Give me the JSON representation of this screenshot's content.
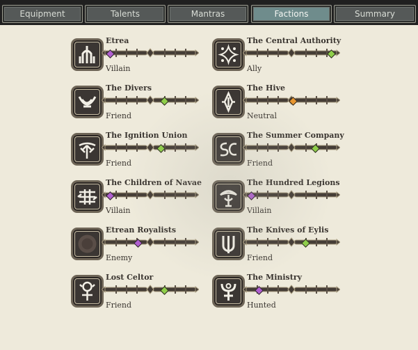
{
  "tabs": [
    {
      "label": "Equipment",
      "active": false
    },
    {
      "label": "Talents",
      "active": false
    },
    {
      "label": "Mantras",
      "active": false
    },
    {
      "label": "Factions",
      "active": true
    },
    {
      "label": "Summary",
      "active": false
    }
  ],
  "factions": [
    {
      "name": "Etrea",
      "status": "Villain",
      "standing": 0.03,
      "marker_color": "#b05fd0",
      "icon": "etrea-emblem-icon"
    },
    {
      "name": "The Central Authority",
      "status": "Ally",
      "standing": 0.93,
      "marker_color": "#8fcf49",
      "icon": "central-authority-emblem-icon"
    },
    {
      "name": "The Divers",
      "status": "Friend",
      "standing": 0.64,
      "marker_color": "#8fcf49",
      "icon": "divers-emblem-icon"
    },
    {
      "name": "The Hive",
      "status": "Neutral",
      "standing": 0.5,
      "marker_color": "#e8962f",
      "icon": "hive-emblem-icon"
    },
    {
      "name": "The Ignition Union",
      "status": "Friend",
      "standing": 0.6,
      "marker_color": "#8fcf49",
      "icon": "ignition-union-emblem-icon"
    },
    {
      "name": "The Summer Company",
      "status": "Friend",
      "standing": 0.75,
      "marker_color": "#8fcf49",
      "icon": "summer-company-emblem-icon"
    },
    {
      "name": "The Children of Navae",
      "status": "Villain",
      "standing": 0.03,
      "marker_color": "#b05fd0",
      "icon": "children-of-navae-emblem-icon"
    },
    {
      "name": "The Hundred Legions",
      "status": "Villain",
      "standing": 0.03,
      "marker_color": "#b05fd0",
      "icon": "hundred-legions-emblem-icon"
    },
    {
      "name": "Etrean Royalists",
      "status": "Enemy",
      "standing": 0.34,
      "marker_color": "#b05fd0",
      "icon": "etrean-royalists-emblem-icon"
    },
    {
      "name": "The Knives of Eylis",
      "status": "Friend",
      "standing": 0.64,
      "marker_color": "#8fcf49",
      "icon": "knives-of-eylis-emblem-icon"
    },
    {
      "name": "Lost Celtor",
      "status": "Friend",
      "standing": 0.64,
      "marker_color": "#8fcf49",
      "icon": "lost-celtor-emblem-icon"
    },
    {
      "name": "The Ministry",
      "status": "Hunted",
      "standing": 0.12,
      "marker_color": "#b05fd0",
      "icon": "ministry-emblem-icon"
    }
  ]
}
